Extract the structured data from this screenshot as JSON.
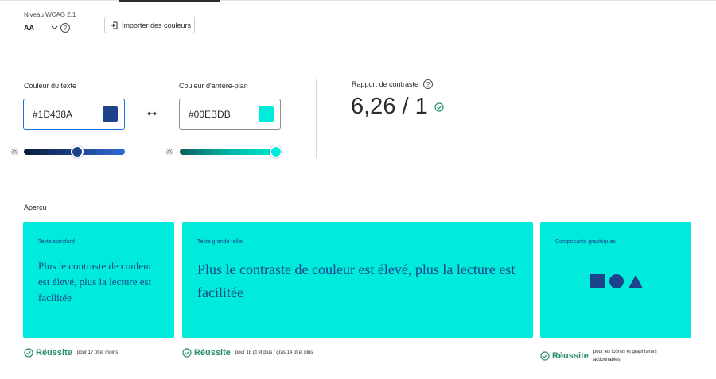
{
  "wcag": {
    "label": "Niveau WCAG 2.1",
    "selected": "AA",
    "help_glyph": "?"
  },
  "import_button": {
    "label": "Importer des couleurs"
  },
  "text_color": {
    "label": "Couleur du texte",
    "value": "#1D438A",
    "swatch": "#1D438A",
    "slider_level": 0.53
  },
  "background_color": {
    "label": "Couleur d'arrière-plan",
    "value": "#00EBDB",
    "swatch": "#00EBDB",
    "slider_level": 0.96
  },
  "contrast": {
    "label": "Rapport de contraste",
    "value": "6,26 / 1",
    "help_glyph": "?"
  },
  "preview": {
    "title": "Aperçu",
    "cards": [
      {
        "title": "Texte standard",
        "body": "Plus le contraste de couleur est élevé, plus la lecture est facilitée"
      },
      {
        "title": "Texte grande taille",
        "body": "Plus le contraste de couleur est élevé, plus la lecture est facilitée"
      },
      {
        "title": "Composants graphiques"
      }
    ],
    "results": [
      {
        "label": "Réussite",
        "note": "pour 17 pt et moins"
      },
      {
        "label": "Réussite",
        "note": "pour 18 pt et plus / gras 14 pt et plus"
      },
      {
        "label": "Réussite",
        "note": "pour les icônes et graphismes actionnables"
      }
    ]
  },
  "colors": {
    "text": "#1D438A",
    "background": "#00EBDB",
    "pass": "#268E6C",
    "focus": "#1473E6"
  },
  "icons": {
    "chevron": "chevron-down-icon",
    "help": "help-icon",
    "import": "import-icon",
    "swap": "swap-icon",
    "brightness": "sun-icon",
    "check": "checkmark-circle-icon",
    "shapes": [
      "square-icon",
      "circle-icon",
      "triangle-icon"
    ]
  }
}
